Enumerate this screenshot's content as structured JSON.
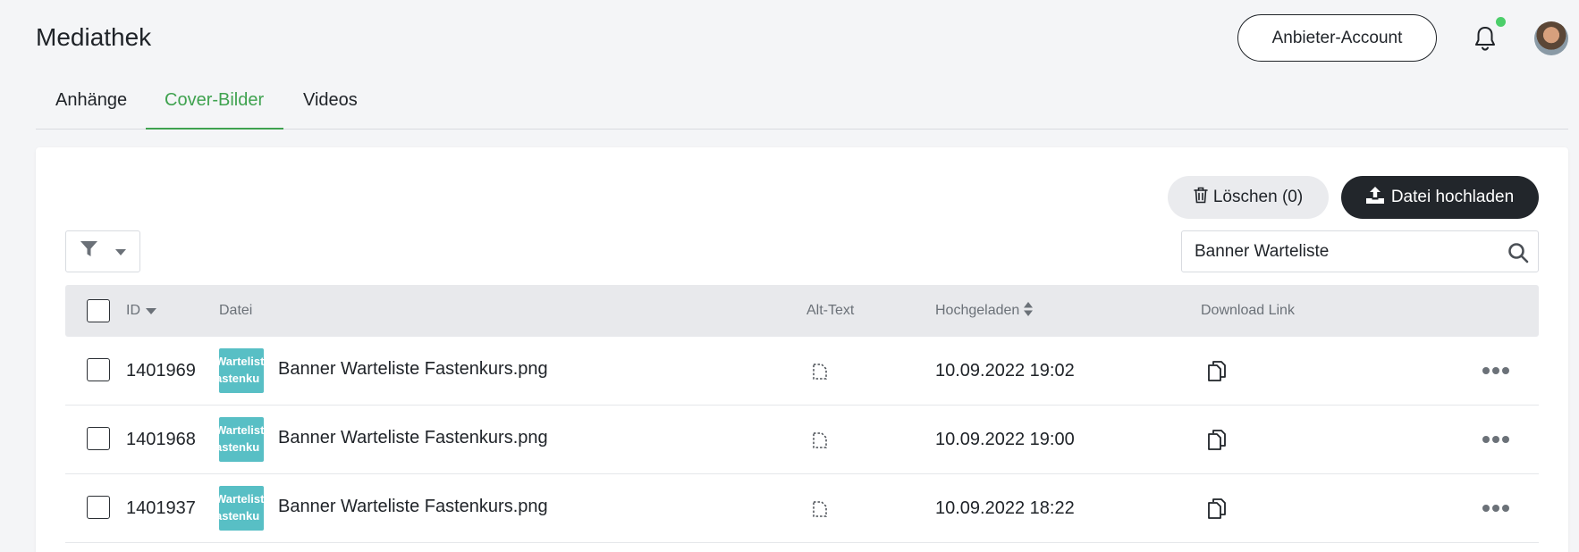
{
  "header": {
    "title": "Mediathek",
    "account_button": "Anbieter-Account"
  },
  "tabs": [
    {
      "label": "Anhänge",
      "active": false
    },
    {
      "label": "Cover-Bilder",
      "active": true
    },
    {
      "label": "Videos",
      "active": false
    }
  ],
  "toolbar": {
    "delete_label": "Löschen (0)",
    "upload_label": "Datei hochladen"
  },
  "search": {
    "value": "Banner Warteliste"
  },
  "table": {
    "columns": {
      "id": "ID",
      "file": "Datei",
      "alt_text": "Alt-Text",
      "uploaded": "Hochgeladen",
      "download_link": "Download Link"
    },
    "rows": [
      {
        "id": "1401969",
        "file": "Banner Warteliste Fastenkurs.png",
        "uploaded": "10.09.2022 19:02",
        "thumb_line1": "Wartelist",
        "thumb_line2": "astenku"
      },
      {
        "id": "1401968",
        "file": "Banner Warteliste Fastenkurs.png",
        "uploaded": "10.09.2022 19:00",
        "thumb_line1": "Wartelist",
        "thumb_line2": "astenku"
      },
      {
        "id": "1401937",
        "file": "Banner Warteliste Fastenkurs.png",
        "uploaded": "10.09.2022 18:22",
        "thumb_line1": "Wartelist",
        "thumb_line2": "astenku"
      }
    ]
  },
  "colors": {
    "accent": "#3fa24f",
    "notification_dot": "#4cce6a",
    "thumb_bg": "#58bfc5",
    "dark_button": "#22262b"
  },
  "icons": [
    "bell-icon",
    "avatar",
    "trash-icon",
    "upload-icon",
    "filter-icon",
    "caret-down-icon",
    "search-icon",
    "sort-desc-icon",
    "sort-icon",
    "alt-text-icon",
    "copy-icon",
    "more-icon"
  ]
}
